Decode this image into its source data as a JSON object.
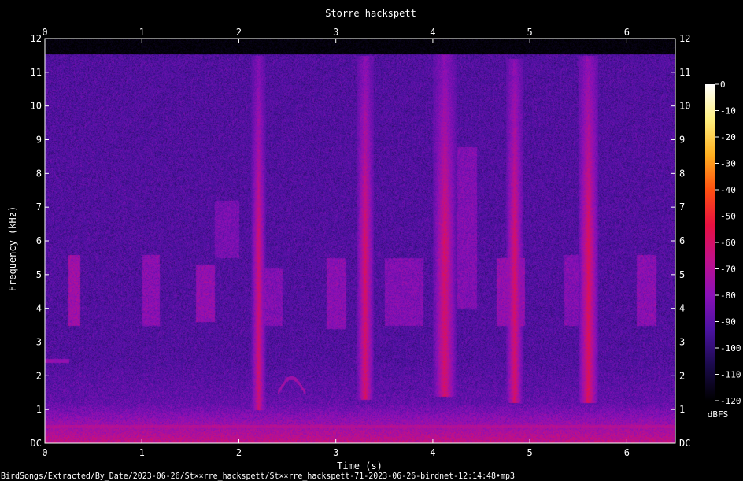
{
  "chart_data": {
    "type": "heatmap",
    "title": "Storre hackspett",
    "xlabel": "Time (s)",
    "ylabel": "Frequency (kHz)",
    "xlim": [
      0,
      6.5
    ],
    "ylim": [
      0,
      12
    ],
    "x_ticks": [
      "0",
      "1",
      "2",
      "3",
      "4",
      "5",
      "6"
    ],
    "y_ticks": [
      "DC",
      "1",
      "2",
      "3",
      "4",
      "5",
      "6",
      "7",
      "8",
      "9",
      "10",
      "11",
      "12"
    ],
    "colorbar": {
      "label": "dBFS",
      "ticks": [
        "0",
        "-10",
        "-20",
        "-30",
        "-40",
        "-50",
        "-60",
        "-70",
        "-80",
        "-90",
        "-100",
        "-110",
        "-120"
      ],
      "range": [
        -120,
        0
      ],
      "colors": [
        "#000000",
        "#1a0a4a",
        "#4a12a0",
        "#8a10b8",
        "#c0108a",
        "#e81040",
        "#ff5010",
        "#ffb020",
        "#fff080",
        "#ffffff"
      ]
    },
    "background_db": -92,
    "noise_ceiling_khz": 11.55,
    "events": [
      {
        "kind": "call",
        "t_start": 0.24,
        "t_end": 0.36,
        "f_low": 3.5,
        "f_high": 5.6,
        "db": -75
      },
      {
        "kind": "call",
        "t_start": 1.0,
        "t_end": 1.18,
        "f_low": 3.5,
        "f_high": 5.6,
        "db": -80
      },
      {
        "kind": "call",
        "t_start": 1.55,
        "t_end": 1.75,
        "f_low": 3.6,
        "f_high": 5.3,
        "db": -78
      },
      {
        "kind": "call",
        "t_start": 1.75,
        "t_end": 2.0,
        "f_low": 5.5,
        "f_high": 7.2,
        "db": -84
      },
      {
        "kind": "drum",
        "t": 2.2,
        "width": 0.08,
        "f_low": 1.0,
        "f_high": 11.5,
        "db": -62
      },
      {
        "kind": "call",
        "t_start": 2.25,
        "t_end": 2.45,
        "f_low": 3.5,
        "f_high": 5.2,
        "db": -82
      },
      {
        "kind": "call",
        "t_start": 2.9,
        "t_end": 3.1,
        "f_low": 3.4,
        "f_high": 5.5,
        "db": -80
      },
      {
        "kind": "drum",
        "t": 3.3,
        "width": 0.09,
        "f_low": 1.3,
        "f_high": 11.5,
        "db": -60
      },
      {
        "kind": "call",
        "t_start": 3.5,
        "t_end": 3.9,
        "f_low": 3.5,
        "f_high": 5.5,
        "db": -82
      },
      {
        "kind": "drum",
        "t": 4.12,
        "width": 0.12,
        "f_low": 1.4,
        "f_high": 11.6,
        "db": -60
      },
      {
        "kind": "call",
        "t_start": 4.25,
        "t_end": 4.45,
        "f_low": 4.0,
        "f_high": 8.8,
        "db": -82
      },
      {
        "kind": "call",
        "t_start": 4.65,
        "t_end": 4.95,
        "f_low": 3.5,
        "f_high": 5.5,
        "db": -78
      },
      {
        "kind": "drum",
        "t": 4.84,
        "width": 0.09,
        "f_low": 1.2,
        "f_high": 11.4,
        "db": -60
      },
      {
        "kind": "call",
        "t_start": 5.35,
        "t_end": 5.5,
        "f_low": 3.5,
        "f_high": 5.6,
        "db": -82
      },
      {
        "kind": "drum",
        "t": 5.6,
        "width": 0.1,
        "f_low": 1.2,
        "f_high": 11.5,
        "db": -58
      },
      {
        "kind": "call",
        "t_start": 6.1,
        "t_end": 6.3,
        "f_low": 3.5,
        "f_high": 5.6,
        "db": -80
      },
      {
        "kind": "tone",
        "t_start": 0.0,
        "t_end": 0.25,
        "f": 2.45,
        "db": -78
      },
      {
        "kind": "tone",
        "t_start": 0.0,
        "t_end": 6.5,
        "f": 0.5,
        "db": -70
      },
      {
        "kind": "arc",
        "t_start": 2.4,
        "t_end": 2.68,
        "f_low": 1.5,
        "f_high": 1.95,
        "db": -75
      }
    ]
  },
  "footer": {
    "filepath": "BirdSongs/Extracted/By_Date/2023-06-26/St××rre_hackspett/St××rre_hackspett-71-2023-06-26-birdnet-12:14:48•mp3"
  }
}
